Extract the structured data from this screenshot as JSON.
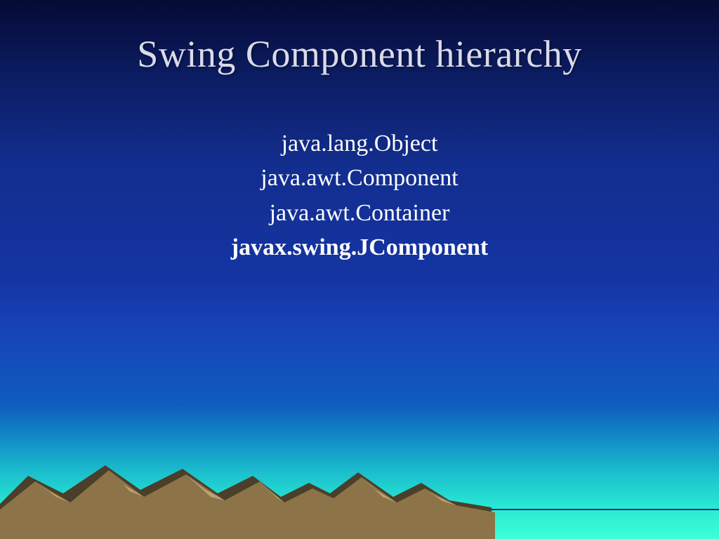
{
  "slide": {
    "title": "Swing Component hierarchy",
    "lines": {
      "l1": "java.lang.Object",
      "l2": "java.awt.Component",
      "l3": "java.awt.Container",
      "l4": "javax.swing.JComponent"
    }
  }
}
